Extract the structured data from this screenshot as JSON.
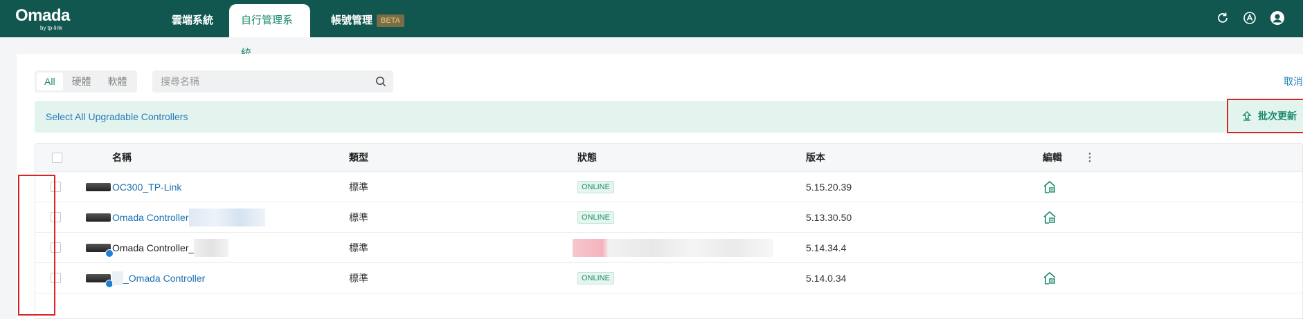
{
  "topbar": {
    "brand": "Omada",
    "brand_sub": "by tp-link",
    "tabs": [
      {
        "label": "雲端系統"
      },
      {
        "label": "自行管理系統"
      },
      {
        "label": "帳號管理",
        "badge": "BETA"
      }
    ],
    "icons": [
      "refresh-icon",
      "upgrade-icon",
      "user-avatar-icon"
    ]
  },
  "filter": {
    "segments": [
      "All",
      "硬體",
      "軟體"
    ],
    "selected": "All",
    "search_placeholder": "搜尋名稱",
    "cancel_label": "取消"
  },
  "banner": {
    "text": "Select All Upgradable Controllers",
    "batch_label": "批次更新"
  },
  "table": {
    "columns": [
      "名稱",
      "類型",
      "狀態",
      "版本",
      "編輯"
    ],
    "rows": [
      {
        "name": "OC300_TP-Link",
        "type": "標準",
        "status": "ONLINE",
        "version": "5.15.20.39"
      },
      {
        "name": "Omada Controller",
        "type": "標準",
        "status": "ONLINE",
        "version": "5.13.30.50"
      },
      {
        "name": "Omada Controller_",
        "type": "標準",
        "status": "",
        "version": "5.14.34.4"
      },
      {
        "name": "_Omada Controller",
        "type": "標準",
        "status": "ONLINE",
        "version": "5.14.0.34"
      }
    ]
  },
  "colors": {
    "topbar_bg": "#12574f",
    "accent_green": "#1a8a6c",
    "link_blue": "#1a6fb0",
    "highlight_red": "#d92222"
  }
}
